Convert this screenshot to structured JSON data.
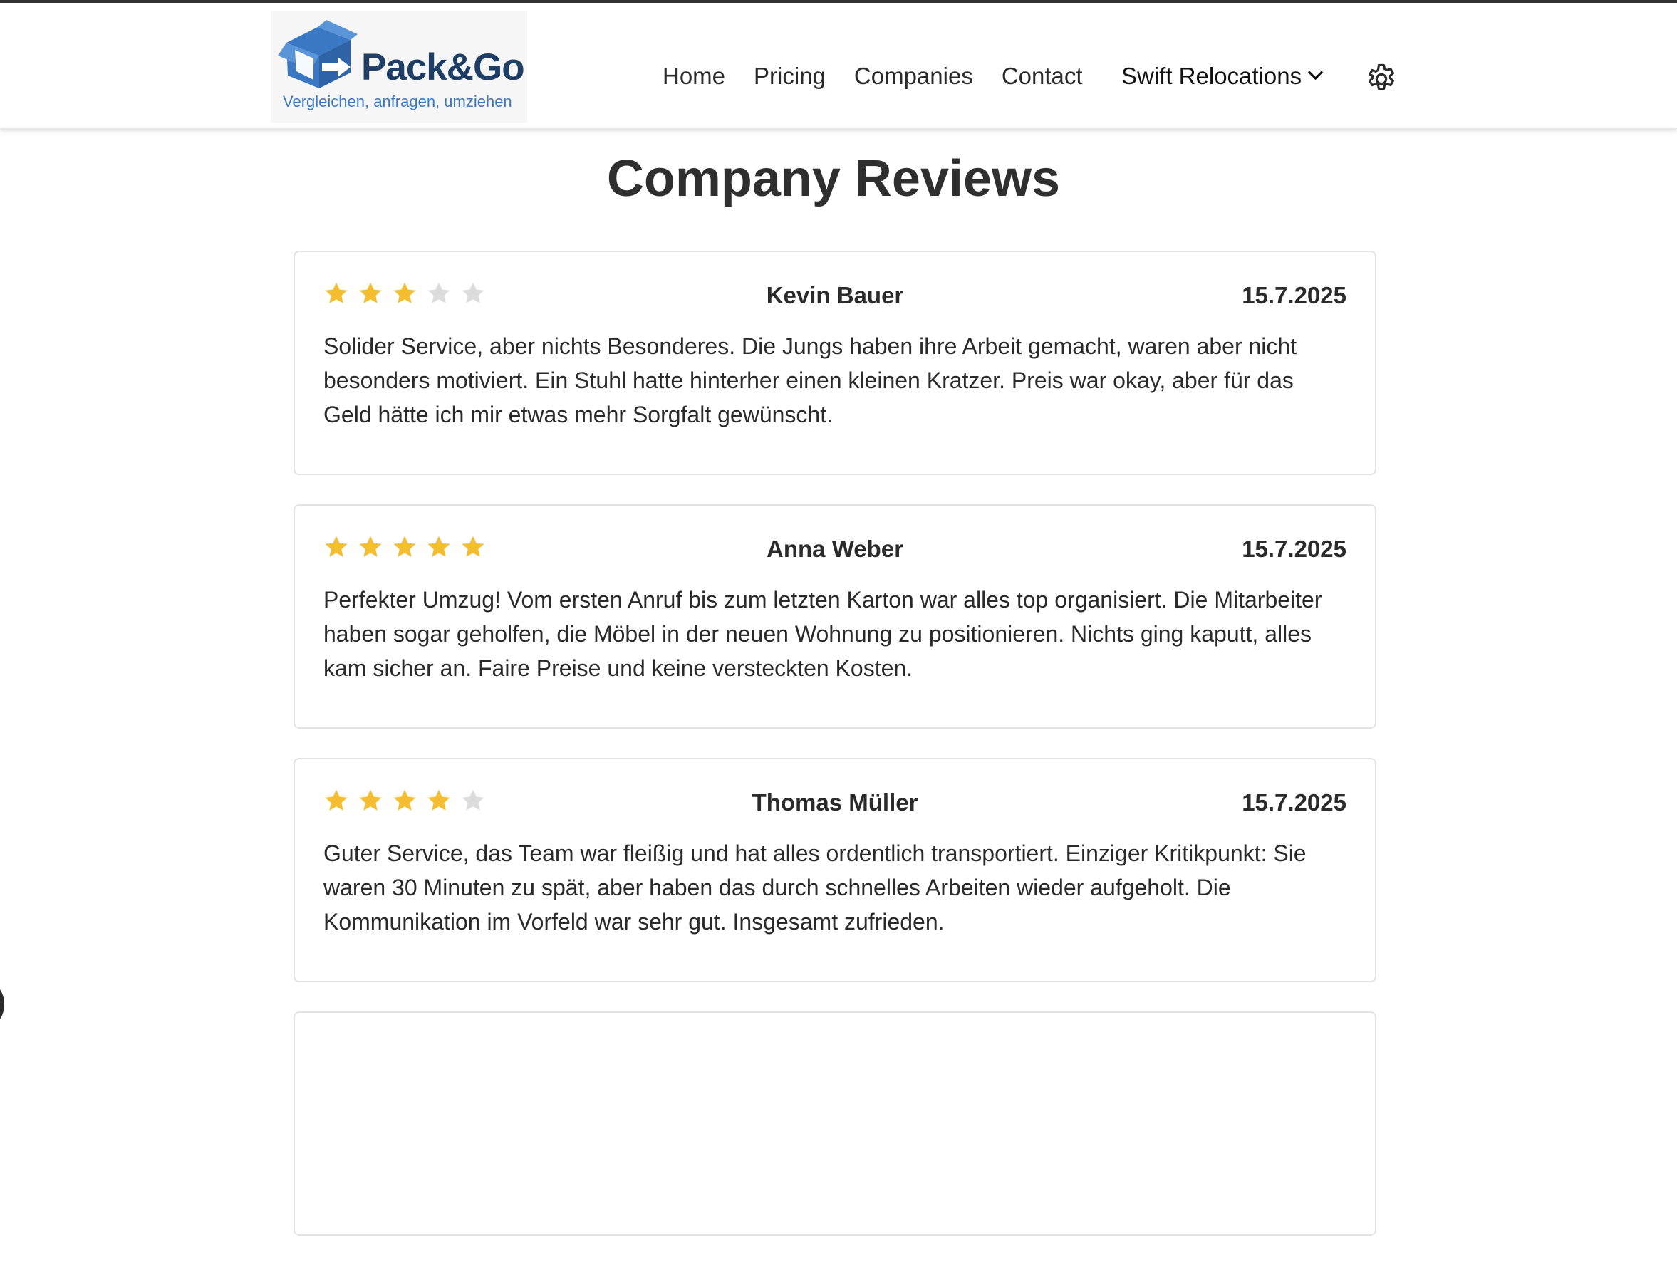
{
  "brand": {
    "name": "Pack&Go",
    "tagline": "Vergleichen, anfragen, umziehen",
    "colors": {
      "primary": "#1e3e66",
      "accent": "#3b78c4"
    }
  },
  "nav": {
    "items": [
      "Home",
      "Pricing",
      "Companies",
      "Contact"
    ]
  },
  "company_selector": {
    "selected": "Swift Relocations",
    "icon": "chevron-down-icon"
  },
  "settings": {
    "icon": "gear-icon"
  },
  "page": {
    "title": "Company Reviews"
  },
  "reviews": [
    {
      "rating": 3,
      "max_rating": 5,
      "name": "Kevin Bauer",
      "date": "15.7.2025",
      "text": "Solider Service, aber nichts Besonderes. Die Jungs haben ihre Arbeit gemacht, waren aber nicht besonders motiviert. Ein Stuhl hatte hinterher einen kleinen Kratzer. Preis war okay, aber für das Geld hätte ich mir etwas mehr Sorgfalt gewünscht."
    },
    {
      "rating": 5,
      "max_rating": 5,
      "name": "Anna Weber",
      "date": "15.7.2025",
      "text": "Perfekter Umzug! Vom ersten Anruf bis zum letzten Karton war alles top organisiert. Die Mitarbeiter haben sogar geholfen, die Möbel in der neuen Wohnung zu positionieren. Nichts ging kaputt, alles kam sicher an. Faire Preise und keine versteckten Kosten."
    },
    {
      "rating": 4,
      "max_rating": 5,
      "name": "Thomas Müller",
      "date": "15.7.2025",
      "text": "Guter Service, das Team war fleißig und hat alles ordentlich transportiert. Einziger Kritikpunkt: Sie waren 30 Minuten zu spät, aber haben das durch schnelles Arbeiten wieder aufgeholt. Die Kommunikation im Vorfeld war sehr gut. Insgesamt zufrieden."
    },
    {
      "rating": null,
      "max_rating": 5,
      "name": "",
      "date": "",
      "text": ""
    }
  ],
  "star_colors": {
    "filled": "#f4bd32",
    "empty": "#dcdcdc"
  }
}
